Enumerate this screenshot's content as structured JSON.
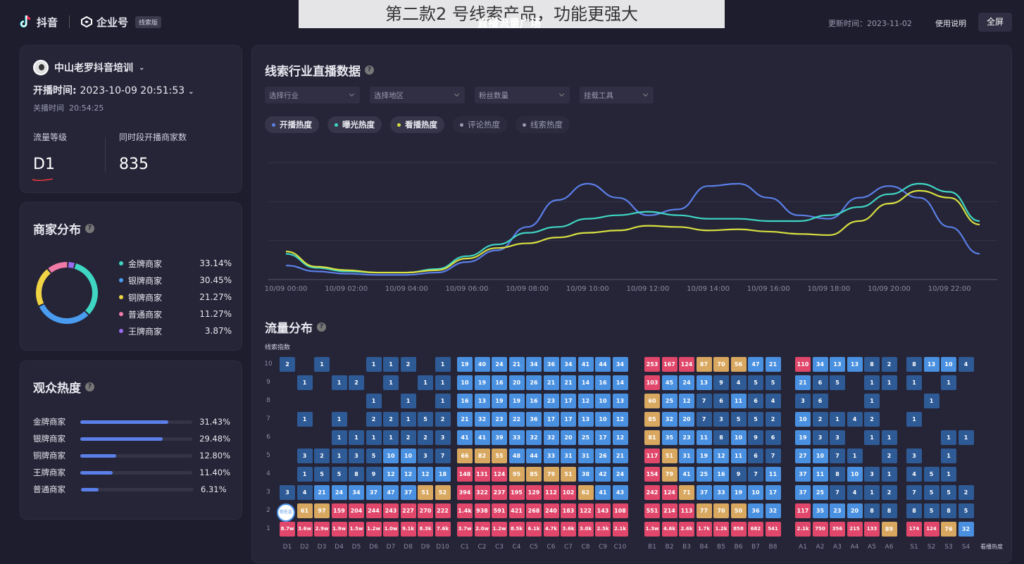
{
  "header": {
    "brand1": "抖音",
    "brand2": "企业号",
    "badge": "线索版",
    "banner": "第二款2 号线索产品，功能更强大",
    "banner_sub": "直播流量广场",
    "updated": "更新时间：2023-11-02",
    "help": "使用说明",
    "fullscreen": "全屏"
  },
  "anchor": {
    "name": "中山老罗抖音培训",
    "start_label": "开播时间:",
    "start_time": "2023-10-09 20:51:53",
    "close_label": "关播时间",
    "close_time": "20:54:25",
    "level_label": "流量等级",
    "level_value": "D1",
    "peers_label": "同时段开播商家数",
    "peers_value": "835"
  },
  "merchant": {
    "title": "商家分布",
    "items": [
      {
        "name": "金牌商家",
        "pct": "33.14%",
        "value": 33.14,
        "color": "#3fd6c4"
      },
      {
        "name": "银牌商家",
        "pct": "30.45%",
        "value": 30.45,
        "color": "#4a9cf0"
      },
      {
        "name": "铜牌商家",
        "pct": "21.27%",
        "value": 21.27,
        "color": "#f0d444"
      },
      {
        "name": "普通商家",
        "pct": "11.27%",
        "value": 11.27,
        "color": "#f07aa6"
      },
      {
        "name": "王牌商家",
        "pct": "3.87%",
        "value": 3.87,
        "color": "#9a6cf0"
      }
    ]
  },
  "audience": {
    "title": "观众热度",
    "items": [
      {
        "name": "金牌商家",
        "pct": "31.43%",
        "value": 0.7857
      },
      {
        "name": "银牌商家",
        "pct": "29.48%",
        "value": 0.737
      },
      {
        "name": "铜牌商家",
        "pct": "12.80%",
        "value": 0.32
      },
      {
        "name": "王牌商家",
        "pct": "11.40%",
        "value": 0.285
      },
      {
        "name": "普通商家",
        "pct": "6.31%",
        "value": 0.158
      }
    ]
  },
  "industry": {
    "title": "线索行业直播数据",
    "filters": [
      "选择行业",
      "选择地区",
      "粉丝数量",
      "挂载工具"
    ],
    "chips": [
      {
        "label": "开播热度",
        "color": "#5b7fe8",
        "active": true
      },
      {
        "label": "曝光热度",
        "color": "#3fd6c4",
        "active": true
      },
      {
        "label": "看播热度",
        "color": "#d8e040",
        "active": true
      },
      {
        "label": "评论热度",
        "color": "#9a9ab0",
        "active": false
      },
      {
        "label": "线索热度",
        "color": "#9a9ab0",
        "active": false
      }
    ]
  },
  "chart_data": {
    "type": "line",
    "x": [
      "10/09 00:00",
      "10/09 01:00",
      "10/09 02:00",
      "10/09 03:00",
      "10/09 04:00",
      "10/09 05:00",
      "10/09 06:00",
      "10/09 07:00",
      "10/09 08:00",
      "10/09 09:00",
      "10/09 10:00",
      "10/09 11:00",
      "10/09 12:00",
      "10/09 13:00",
      "10/09 14:00",
      "10/09 15:00",
      "10/09 16:00",
      "10/09 17:00",
      "10/09 18:00",
      "10/09 19:00",
      "10/09 20:00",
      "10/09 21:00",
      "10/09 22:00",
      "10/09 23:00"
    ],
    "xticks": [
      "10/09 00:00",
      "10/09 02:00",
      "10/09 04:00",
      "10/09 06:00",
      "10/09 08:00",
      "10/09 10:00",
      "10/09 12:00",
      "10/09 14:00",
      "10/09 16:00",
      "10/09 18:00",
      "10/09 20:00",
      "10/09 22:00"
    ],
    "ylim": [
      0,
      100
    ],
    "series": [
      {
        "label": "开播热度",
        "color": "#5b7fe8",
        "values": [
          12,
          7,
          5,
          4,
          4,
          6,
          15,
          25,
          45,
          68,
          82,
          70,
          55,
          60,
          80,
          82,
          70,
          55,
          52,
          70,
          80,
          70,
          45,
          22
        ]
      },
      {
        "label": "曝光热度",
        "color": "#3fd6c4",
        "values": [
          22,
          10,
          7,
          6,
          6,
          9,
          20,
          30,
          40,
          45,
          52,
          55,
          58,
          55,
          52,
          52,
          50,
          50,
          55,
          62,
          73,
          82,
          75,
          50
        ]
      },
      {
        "label": "看播热度",
        "color": "#d8e040",
        "values": [
          24,
          11,
          8,
          6,
          6,
          8,
          18,
          27,
          31,
          36,
          40,
          42,
          46,
          45,
          42,
          43,
          41,
          39,
          38,
          50,
          65,
          76,
          70,
          47
        ]
      }
    ]
  },
  "flow": {
    "title": "流量分布",
    "index_label": "线索指数",
    "current_tag": "你在这",
    "view_heat": "看播热度",
    "y_levels": [
      "10",
      "9",
      "8",
      "7",
      "6",
      "5",
      "4",
      "3",
      "2",
      "1"
    ],
    "groups": [
      {
        "cols": [
          "D1",
          "D2",
          "D3",
          "D4",
          "D5",
          "D6",
          "D7",
          "D8",
          "D9",
          "D10"
        ],
        "rows": [
          [
            "2",
            "",
            "1",
            "",
            "",
            "1",
            "1",
            "2",
            "",
            "1"
          ],
          [
            "",
            "1",
            "",
            "1",
            "2",
            "",
            "1",
            "",
            "1",
            "1"
          ],
          [
            "",
            "",
            "",
            "",
            "",
            "1",
            "",
            "1",
            "",
            "1"
          ],
          [
            "",
            "1",
            "",
            "1",
            "",
            "2",
            "2",
            "1",
            "5",
            "2"
          ],
          [
            "",
            "",
            "",
            "1",
            "1",
            "1",
            "1",
            "2",
            "2",
            "3"
          ],
          [
            "",
            "3",
            "2",
            "1",
            "3",
            "5",
            "10",
            "10",
            "3",
            "7"
          ],
          [
            "",
            "1",
            "5",
            "5",
            "8",
            "9",
            "12",
            "12",
            "12",
            "18"
          ],
          [
            "3",
            "4",
            "21",
            "24",
            "34",
            "37",
            "47",
            "37",
            "51",
            "52"
          ],
          [
            "",
            "61",
            "97",
            "159",
            "204",
            "244",
            "243",
            "227",
            "270",
            "222"
          ],
          [
            "8.7w",
            "3.6w",
            "2.9w",
            "1.9w",
            "1.5w",
            "1.2w",
            "1.0w",
            "9.1k",
            "8.3k",
            "7.6k"
          ]
        ]
      },
      {
        "cols": [
          "C1",
          "C2",
          "C3",
          "C4",
          "C5",
          "C6",
          "C7",
          "C8",
          "C9",
          "C10"
        ],
        "rows": [
          [
            "19",
            "40",
            "24",
            "21",
            "34",
            "36",
            "34",
            "41",
            "44",
            "34"
          ],
          [
            "10",
            "19",
            "16",
            "20",
            "26",
            "21",
            "21",
            "14",
            "16",
            "14"
          ],
          [
            "16",
            "13",
            "19",
            "19",
            "16",
            "23",
            "17",
            "12",
            "10",
            "13"
          ],
          [
            "21",
            "32",
            "23",
            "22",
            "36",
            "17",
            "17",
            "13",
            "10",
            "12"
          ],
          [
            "41",
            "41",
            "39",
            "33",
            "32",
            "32",
            "20",
            "25",
            "17",
            "12"
          ],
          [
            "66",
            "82",
            "55",
            "48",
            "44",
            "33",
            "31",
            "31",
            "26",
            "21"
          ],
          [
            "148",
            "131",
            "124",
            "95",
            "85",
            "79",
            "51",
            "38",
            "42",
            "24"
          ],
          [
            "394",
            "322",
            "237",
            "195",
            "129",
            "112",
            "102",
            "62",
            "41",
            "43"
          ],
          [
            "1.4k",
            "938",
            "591",
            "421",
            "268",
            "240",
            "183",
            "122",
            "143",
            "108"
          ],
          [
            "3.7w",
            "2.0w",
            "1.2w",
            "8.5k",
            "6.1k",
            "4.7k",
            "3.6k",
            "3.0k",
            "2.5k",
            "2.1k"
          ]
        ]
      },
      {
        "cols": [
          "B1",
          "B2",
          "B3",
          "B4",
          "B5",
          "B6",
          "B7",
          "B8"
        ],
        "rows": [
          [
            "253",
            "167",
            "124",
            "87",
            "70",
            "56",
            "47",
            "21"
          ],
          [
            "103",
            "45",
            "24",
            "13",
            "9",
            "4",
            "5",
            "5"
          ],
          [
            "60",
            "25",
            "12",
            "7",
            "6",
            "11",
            "6",
            "4"
          ],
          [
            "85",
            "32",
            "20",
            "7",
            "3",
            "5",
            "5",
            "2"
          ],
          [
            "81",
            "35",
            "23",
            "11",
            "8",
            "10",
            "9",
            "6"
          ],
          [
            "117",
            "51",
            "31",
            "19",
            "12",
            "11",
            "6",
            "7"
          ],
          [
            "154",
            "79",
            "41",
            "25",
            "16",
            "9",
            "7",
            "11"
          ],
          [
            "242",
            "124",
            "71",
            "37",
            "33",
            "19",
            "10",
            "17"
          ],
          [
            "551",
            "214",
            "113",
            "77",
            "70",
            "50",
            "36",
            "32"
          ],
          [
            "1.3w",
            "4.6k",
            "2.6k",
            "1.7k",
            "1.2k",
            "858",
            "682",
            "541"
          ]
        ]
      },
      {
        "cols": [
          "A1",
          "A2",
          "A3",
          "A4",
          "A5",
          "A6"
        ],
        "rows": [
          [
            "110",
            "34",
            "13",
            "13",
            "8",
            "2"
          ],
          [
            "21",
            "6",
            "5",
            "",
            "1",
            "1"
          ],
          [
            "3",
            "6",
            "",
            "",
            "1",
            ""
          ],
          [
            "10",
            "2",
            "1",
            "4",
            "2",
            ""
          ],
          [
            "19",
            "3",
            "3",
            "",
            "1",
            "1"
          ],
          [
            "27",
            "10",
            "7",
            "1",
            "",
            "2"
          ],
          [
            "37",
            "11",
            "8",
            "10",
            "3",
            "1"
          ],
          [
            "37",
            "25",
            "7",
            "4",
            "1",
            "2"
          ],
          [
            "117",
            "35",
            "23",
            "20",
            "8",
            "8"
          ],
          [
            "2.1k",
            "750",
            "356",
            "215",
            "133",
            "89"
          ]
        ]
      },
      {
        "cols": [
          "S1",
          "S2",
          "S3",
          "S4"
        ],
        "rows": [
          [
            "8",
            "13",
            "10",
            "4"
          ],
          [
            "1",
            "",
            "1",
            ""
          ],
          [
            "",
            "1",
            "",
            ""
          ],
          [
            "1",
            "",
            "",
            ""
          ],
          [
            "",
            "",
            "1",
            "1"
          ],
          [
            "3",
            "",
            "1",
            ""
          ],
          [
            "4",
            "5",
            "1",
            ""
          ],
          [
            "7",
            "5",
            "5",
            "2"
          ],
          [
            "8",
            "5",
            "8",
            "5"
          ],
          [
            "174",
            "124",
            "76",
            "32"
          ]
        ]
      }
    ]
  }
}
